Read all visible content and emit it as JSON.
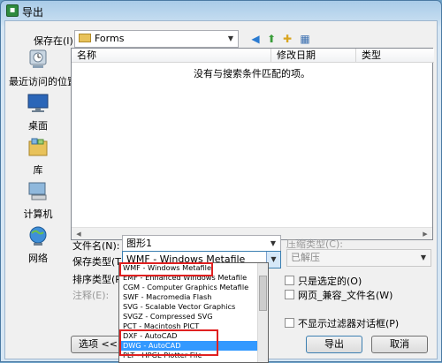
{
  "window": {
    "title": "导出"
  },
  "save_in": {
    "label": "保存在(I):",
    "value": "Forms"
  },
  "places": [
    {
      "label": "最近访问的位置",
      "icon": "recent-places-icon"
    },
    {
      "label": "桌面",
      "icon": "desktop-icon"
    },
    {
      "label": "库",
      "icon": "libraries-icon"
    },
    {
      "label": "计算机",
      "icon": "computer-icon"
    },
    {
      "label": "网络",
      "icon": "network-icon"
    }
  ],
  "file_list": {
    "columns": [
      "名称",
      "修改日期",
      "类型"
    ],
    "empty_message": "没有与搜索条件匹配的项。"
  },
  "filename": {
    "label": "文件名(N):",
    "value": "图形1"
  },
  "save_type": {
    "label": "保存类型(T):",
    "value": "WMF - Windows Metafile"
  },
  "sort_type": {
    "label": "排序类型(R):"
  },
  "notes": {
    "label": "注释(E):"
  },
  "compression": {
    "label": "压缩类型(C):",
    "value": "已解压"
  },
  "checkboxes": {
    "selected_only": "只是选定的(O)",
    "web_compatible": "网页_兼容_文件名(W)",
    "no_filter_dialog": "不显示过滤器对话框(P)"
  },
  "buttons": {
    "options": "选项 <<",
    "export": "导出",
    "cancel": "取消"
  },
  "dropdown_options": [
    "WMF - Windows Metafile",
    "EMF - Enhanced Windows Metafile",
    "CGM - Computer Graphics Metafile",
    "SWF - Macromedia Flash",
    "SVG - Scalable Vector Graphics",
    "SVGZ - Compressed SVG",
    "PCT - Macintosh PICT",
    "DXF - AutoCAD",
    "DWG - AutoCAD",
    "PLT - HPGL Plotter File"
  ],
  "dropdown_selected_index": 8,
  "colors": {
    "selection": "#3399ff",
    "highlight_box": "#e02020"
  }
}
